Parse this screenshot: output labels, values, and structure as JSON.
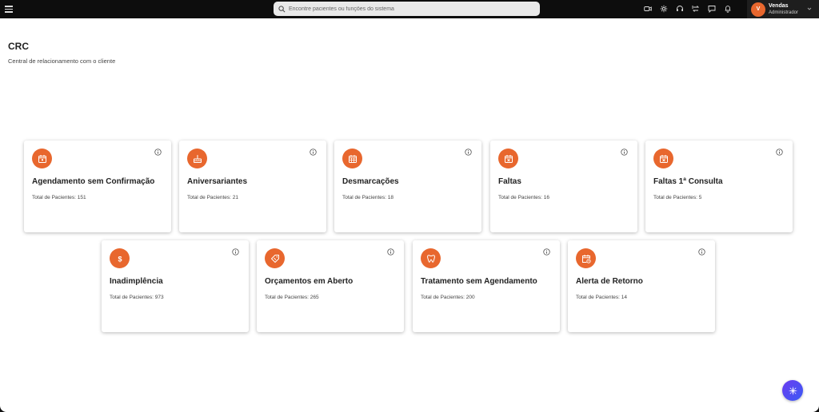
{
  "topbar": {
    "search_placeholder": "Encontre pacientes ou funções do sistema",
    "icons": [
      "video-icon",
      "sparkle-icon",
      "headset-icon",
      "transfer-icon",
      "chat-icon",
      "bell-icon"
    ],
    "user": {
      "initial": "V",
      "name": "Vendas",
      "role": "Administrador"
    }
  },
  "page": {
    "title": "CRC",
    "subtitle": "Central de relacionamento com o cliente"
  },
  "cards": [
    {
      "title": "Agendamento sem Confirmação",
      "total_label": "Total de Pacientes:",
      "total": "151",
      "icon": "calendar-icon"
    },
    {
      "title": "Aniversariantes",
      "total_label": "Total de Pacientes:",
      "total": "21",
      "icon": "cake-icon"
    },
    {
      "title": "Desmarcações",
      "total_label": "Total de Pacientes:",
      "total": "18",
      "icon": "calendar-grid-icon"
    },
    {
      "title": "Faltas",
      "total_label": "Total de Pacientes:",
      "total": "16",
      "icon": "calendar-x-icon"
    },
    {
      "title": "Faltas 1ª Consulta",
      "total_label": "Total de Pacientes:",
      "total": "5",
      "icon": "calendar-x-icon"
    },
    {
      "title": "Inadimplência",
      "total_label": "Total de Pacientes:",
      "total": "973",
      "icon": "dollar-icon"
    },
    {
      "title": "Orçamentos em Aberto",
      "total_label": "Total de Pacientes:",
      "total": "265",
      "icon": "tag-icon"
    },
    {
      "title": "Tratamento sem Agendamento",
      "total_label": "Total de Pacientes:",
      "total": "200",
      "icon": "tooth-icon"
    },
    {
      "title": "Alerta de Retorno",
      "total_label": "Total de Pacientes:",
      "total": "14",
      "icon": "calendar-clock-icon"
    }
  ],
  "colors": {
    "accent": "#e8672e",
    "topbar": "#0d0d0d",
    "fab": "#5a45f2"
  }
}
